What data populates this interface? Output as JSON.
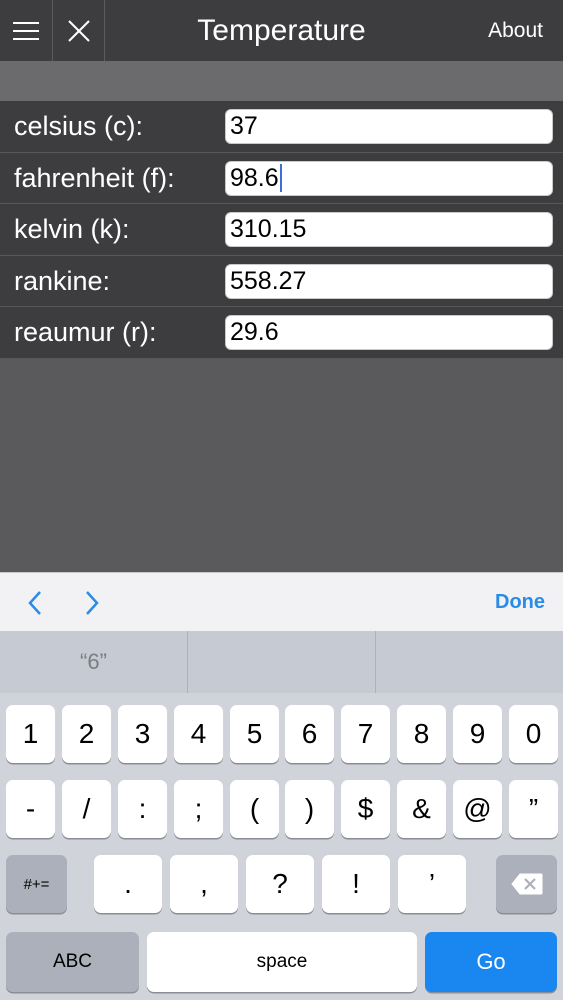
{
  "navbar": {
    "menu_icon": "hamburger-menu-icon",
    "close_icon": "close-x-icon",
    "title": "Temperature",
    "about_label": "About"
  },
  "rows": [
    {
      "label": "celsius (c):",
      "value": "37"
    },
    {
      "label": "fahrenheit (f):",
      "value": "98.6"
    },
    {
      "label": "kelvin (k):",
      "value": "310.15"
    },
    {
      "label": "rankine:",
      "value": "558.27"
    },
    {
      "label": "reaumur (r):",
      "value": "29.6"
    }
  ],
  "accessory": {
    "prev_icon": "chevron-left-icon",
    "next_icon": "chevron-right-icon",
    "done_label": "Done"
  },
  "suggestions": [
    "“6”",
    "",
    ""
  ],
  "keyboard": {
    "row1": [
      "1",
      "2",
      "3",
      "4",
      "5",
      "6",
      "7",
      "8",
      "9",
      "0"
    ],
    "row2": [
      "-",
      "/",
      ":",
      ";",
      "(",
      ")",
      "$",
      "&",
      "@",
      "”"
    ],
    "row3_symbols": "#+=",
    "row3": [
      ".",
      ",",
      "?",
      "!",
      "’"
    ],
    "backspace_icon": "backspace-icon",
    "abc_label": "ABC",
    "space_label": "space",
    "go_label": "Go"
  },
  "colors": {
    "navbar_bg": "#3d3d3f",
    "accent_blue": "#2a8ce6",
    "go_key": "#1a86f0",
    "caret": "#3b6fd6"
  }
}
